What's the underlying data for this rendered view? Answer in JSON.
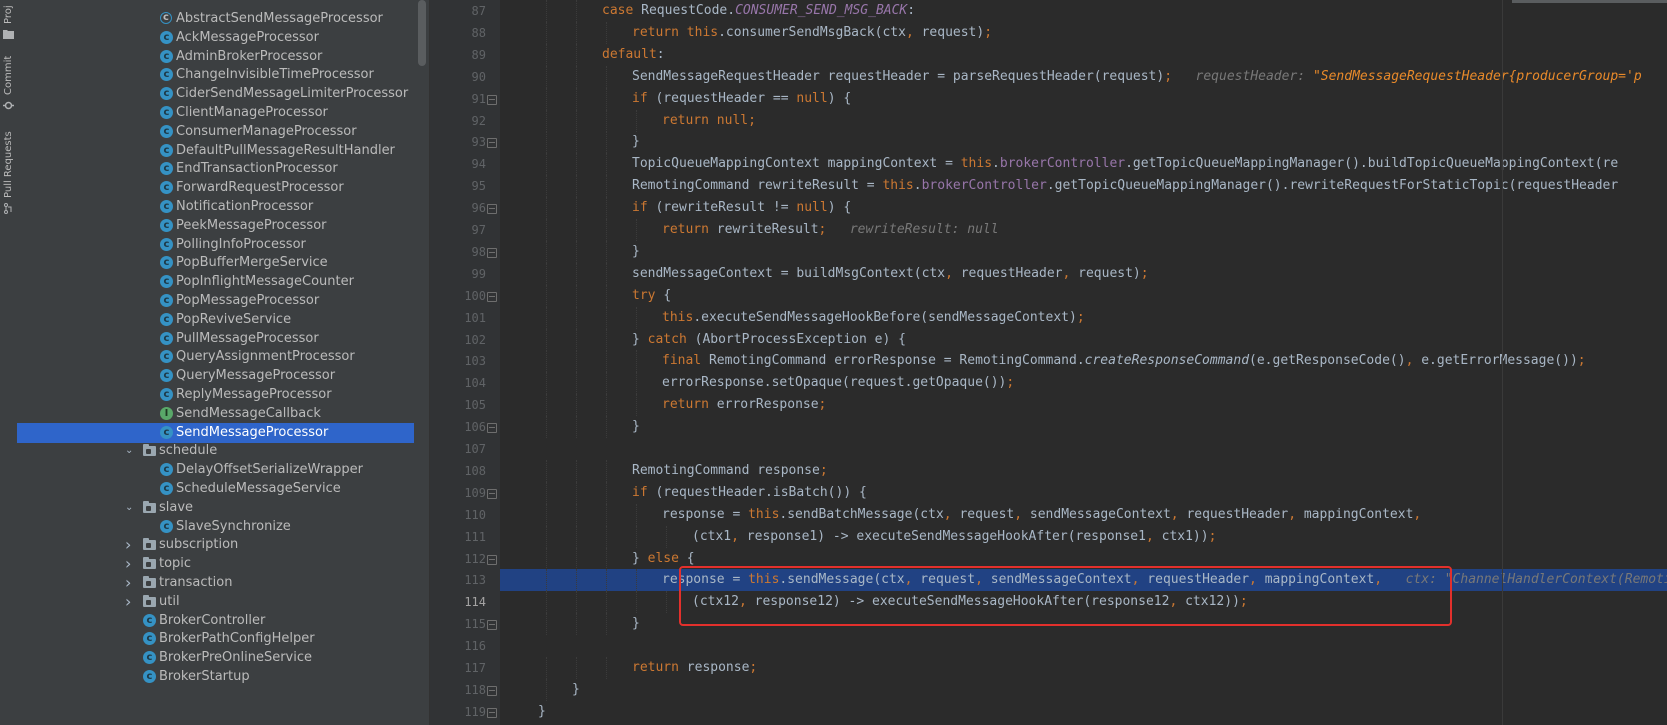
{
  "toolstrip": {
    "tabs": [
      {
        "label": "Proj"
      },
      {
        "label": "Commit"
      },
      {
        "label": "Pull Requests"
      }
    ]
  },
  "tree": {
    "items": [
      {
        "label": "AbstractSendMessageProcessor",
        "icon": "abstract-class-icon",
        "depth": 2
      },
      {
        "label": "AckMessageProcessor",
        "icon": "class-icon",
        "depth": 2
      },
      {
        "label": "AdminBrokerProcessor",
        "icon": "class-icon",
        "depth": 2
      },
      {
        "label": "ChangeInvisibleTimeProcessor",
        "icon": "class-icon",
        "depth": 2
      },
      {
        "label": "CiderSendMessageLimiterProcessor",
        "icon": "class-icon",
        "depth": 2
      },
      {
        "label": "ClientManageProcessor",
        "icon": "class-icon",
        "depth": 2
      },
      {
        "label": "ConsumerManageProcessor",
        "icon": "class-icon",
        "depth": 2
      },
      {
        "label": "DefaultPullMessageResultHandler",
        "icon": "class-icon",
        "depth": 2
      },
      {
        "label": "EndTransactionProcessor",
        "icon": "class-icon",
        "depth": 2
      },
      {
        "label": "ForwardRequestProcessor",
        "icon": "class-icon",
        "depth": 2
      },
      {
        "label": "NotificationProcessor",
        "icon": "class-icon",
        "depth": 2
      },
      {
        "label": "PeekMessageProcessor",
        "icon": "class-icon",
        "depth": 2
      },
      {
        "label": "PollingInfoProcessor",
        "icon": "class-icon",
        "depth": 2
      },
      {
        "label": "PopBufferMergeService",
        "icon": "class-icon",
        "depth": 2
      },
      {
        "label": "PopInflightMessageCounter",
        "icon": "class-icon",
        "depth": 2
      },
      {
        "label": "PopMessageProcessor",
        "icon": "class-icon",
        "depth": 2
      },
      {
        "label": "PopReviveService",
        "icon": "class-icon",
        "depth": 2
      },
      {
        "label": "PullMessageProcessor",
        "icon": "class-icon",
        "depth": 2
      },
      {
        "label": "QueryAssignmentProcessor",
        "icon": "class-icon",
        "depth": 2
      },
      {
        "label": "QueryMessageProcessor",
        "icon": "class-icon",
        "depth": 2
      },
      {
        "label": "ReplyMessageProcessor",
        "icon": "class-icon",
        "depth": 2
      },
      {
        "label": "SendMessageCallback",
        "icon": "interface-icon",
        "depth": 2
      },
      {
        "label": "SendMessageProcessor",
        "icon": "class-icon",
        "depth": 2,
        "selected": true
      },
      {
        "label": "schedule",
        "icon": "folder-icon",
        "depth": 1,
        "arrow": "expanded"
      },
      {
        "label": "DelayOffsetSerializeWrapper",
        "icon": "class-icon",
        "depth": 2
      },
      {
        "label": "ScheduleMessageService",
        "icon": "class-icon",
        "depth": 2
      },
      {
        "label": "slave",
        "icon": "folder-icon",
        "depth": 1,
        "arrow": "expanded"
      },
      {
        "label": "SlaveSynchronize",
        "icon": "class-icon",
        "depth": 2
      },
      {
        "label": "subscription",
        "icon": "folder-icon",
        "depth": 1,
        "arrow": "collapsed"
      },
      {
        "label": "topic",
        "icon": "folder-icon",
        "depth": 1,
        "arrow": "collapsed"
      },
      {
        "label": "transaction",
        "icon": "folder-icon",
        "depth": 1,
        "arrow": "collapsed"
      },
      {
        "label": "util",
        "icon": "folder-icon",
        "depth": 1,
        "arrow": "collapsed"
      },
      {
        "label": "BrokerController",
        "icon": "class-icon",
        "depth": 1
      },
      {
        "label": "BrokerPathConfigHelper",
        "icon": "class-icon",
        "depth": 1
      },
      {
        "label": "BrokerPreOnlineService",
        "icon": "class-icon",
        "depth": 1
      },
      {
        "label": "BrokerStartup",
        "icon": "class-icon",
        "depth": 1
      }
    ]
  },
  "editor": {
    "current_line": "114",
    "lines": [
      {
        "n": "87",
        "indent": 3,
        "fold": false,
        "segs": [
          [
            "kw",
            "case "
          ],
          [
            "t",
            "RequestCode."
          ],
          [
            "itl",
            "CONSUMER_SEND_MSG_BACK"
          ],
          [
            "t",
            ":"
          ]
        ]
      },
      {
        "n": "88",
        "indent": 4,
        "fold": false,
        "segs": [
          [
            "kw",
            "return this"
          ],
          [
            "t",
            ".consumerSendMsgBack(ctx"
          ],
          [
            "kw",
            ", "
          ],
          [
            "t",
            "request)"
          ],
          [
            "kw",
            ";"
          ]
        ]
      },
      {
        "n": "89",
        "indent": 3,
        "fold": false,
        "segs": [
          [
            "kw",
            "default"
          ],
          [
            "t",
            ":"
          ]
        ]
      },
      {
        "n": "90",
        "indent": 4,
        "fold": false,
        "segs": [
          [
            "t",
            "SendMessageRequestHeader requestHeader = parseRequestHeader(request)"
          ],
          [
            "kw",
            ";"
          ],
          [
            "hint",
            "   requestHeader: "
          ],
          [
            "hintstr",
            "\"SendMessageRequestHeader{producerGroup='p"
          ]
        ]
      },
      {
        "n": "91",
        "indent": 4,
        "fold": true,
        "segs": [
          [
            "kw",
            "if "
          ],
          [
            "t",
            "(requestHeader == "
          ],
          [
            "kw",
            "null"
          ],
          [
            "t",
            ") {"
          ]
        ]
      },
      {
        "n": "92",
        "indent": 5,
        "fold": false,
        "segs": [
          [
            "kw",
            "return null;"
          ]
        ]
      },
      {
        "n": "93",
        "indent": 4,
        "fold": true,
        "segs": [
          [
            "t",
            "}"
          ]
        ]
      },
      {
        "n": "94",
        "indent": 4,
        "fold": false,
        "segs": [
          [
            "t",
            "TopicQueueMappingContext mappingContext = "
          ],
          [
            "kw",
            "this"
          ],
          [
            "t",
            "."
          ],
          [
            "fld",
            "brokerController"
          ],
          [
            "t",
            ".getTopicQueueMappingManager().buildTopicQueueMappingContext(re"
          ]
        ]
      },
      {
        "n": "95",
        "indent": 4,
        "fold": false,
        "segs": [
          [
            "t",
            "RemotingCommand rewriteResult = "
          ],
          [
            "kw",
            "this"
          ],
          [
            "t",
            "."
          ],
          [
            "fld",
            "brokerController"
          ],
          [
            "t",
            ".getTopicQueueMappingManager().rewriteRequestForStaticTopic(requestHeader"
          ]
        ]
      },
      {
        "n": "96",
        "indent": 4,
        "fold": true,
        "segs": [
          [
            "kw",
            "if "
          ],
          [
            "t",
            "(rewriteResult != "
          ],
          [
            "kw",
            "null"
          ],
          [
            "t",
            ") {"
          ]
        ]
      },
      {
        "n": "97",
        "indent": 5,
        "fold": false,
        "segs": [
          [
            "kw",
            "return "
          ],
          [
            "t",
            "rewriteResult"
          ],
          [
            "kw",
            ";"
          ],
          [
            "hint",
            "   rewriteResult: null"
          ]
        ]
      },
      {
        "n": "98",
        "indent": 4,
        "fold": true,
        "segs": [
          [
            "t",
            "}"
          ]
        ]
      },
      {
        "n": "99",
        "indent": 4,
        "fold": false,
        "segs": [
          [
            "t",
            "sendMessageContext = buildMsgContext(ctx"
          ],
          [
            "kw",
            ", "
          ],
          [
            "t",
            "requestHeader"
          ],
          [
            "kw",
            ", "
          ],
          [
            "t",
            "request)"
          ],
          [
            "kw",
            ";"
          ]
        ]
      },
      {
        "n": "100",
        "indent": 4,
        "fold": true,
        "segs": [
          [
            "kw",
            "try "
          ],
          [
            "t",
            "{"
          ]
        ]
      },
      {
        "n": "101",
        "indent": 5,
        "fold": false,
        "segs": [
          [
            "kw",
            "this"
          ],
          [
            "t",
            ".executeSendMessageHookBefore(sendMessageContext)"
          ],
          [
            "kw",
            ";"
          ]
        ]
      },
      {
        "n": "102",
        "indent": 4,
        "fold": false,
        "segs": [
          [
            "t",
            "} "
          ],
          [
            "kw",
            "catch "
          ],
          [
            "t",
            "(AbortProcessException e) {"
          ]
        ]
      },
      {
        "n": "103",
        "indent": 5,
        "fold": false,
        "segs": [
          [
            "kw",
            "final "
          ],
          [
            "t",
            "RemotingCommand errorResponse = RemotingCommand."
          ],
          [
            "it",
            "createResponseCommand"
          ],
          [
            "t",
            "(e.getResponseCode()"
          ],
          [
            "kw",
            ", "
          ],
          [
            "t",
            "e.getErrorMessage())"
          ],
          [
            "kw",
            ";"
          ]
        ]
      },
      {
        "n": "104",
        "indent": 5,
        "fold": false,
        "segs": [
          [
            "t",
            "errorResponse.setOpaque(request.getOpaque())"
          ],
          [
            "kw",
            ";"
          ]
        ]
      },
      {
        "n": "105",
        "indent": 5,
        "fold": false,
        "segs": [
          [
            "kw",
            "return "
          ],
          [
            "t",
            "errorResponse"
          ],
          [
            "kw",
            ";"
          ]
        ]
      },
      {
        "n": "106",
        "indent": 4,
        "fold": true,
        "segs": [
          [
            "t",
            "}"
          ]
        ]
      },
      {
        "n": "107",
        "indent": 0,
        "fold": false,
        "segs": []
      },
      {
        "n": "108",
        "indent": 4,
        "fold": false,
        "segs": [
          [
            "t",
            "RemotingCommand response"
          ],
          [
            "kw",
            ";"
          ]
        ]
      },
      {
        "n": "109",
        "indent": 4,
        "fold": true,
        "segs": [
          [
            "kw",
            "if "
          ],
          [
            "t",
            "(requestHeader.isBatch()) {"
          ]
        ]
      },
      {
        "n": "110",
        "indent": 5,
        "fold": false,
        "segs": [
          [
            "t",
            "response = "
          ],
          [
            "kw",
            "this"
          ],
          [
            "t",
            ".sendBatchMessage(ctx"
          ],
          [
            "kw",
            ", "
          ],
          [
            "t",
            "request"
          ],
          [
            "kw",
            ", "
          ],
          [
            "t",
            "sendMessageContext"
          ],
          [
            "kw",
            ", "
          ],
          [
            "t",
            "requestHeader"
          ],
          [
            "kw",
            ", "
          ],
          [
            "t",
            "mappingContext"
          ],
          [
            "kw",
            ","
          ]
        ]
      },
      {
        "n": "111",
        "indent": 6,
        "fold": false,
        "segs": [
          [
            "t",
            "(ctx1"
          ],
          [
            "kw",
            ", "
          ],
          [
            "t",
            "response1) -> executeSendMessageHookAfter(response1"
          ],
          [
            "kw",
            ", "
          ],
          [
            "t",
            "ctx1))"
          ],
          [
            "kw",
            ";"
          ]
        ]
      },
      {
        "n": "112",
        "indent": 4,
        "fold": true,
        "segs": [
          [
            "t",
            "} "
          ],
          [
            "kw",
            "else "
          ],
          [
            "t",
            "{"
          ]
        ]
      },
      {
        "n": "113",
        "indent": 5,
        "fold": false,
        "hl": true,
        "segs": [
          [
            "t",
            "response = "
          ],
          [
            "kw",
            "this"
          ],
          [
            "t",
            ".sendMessage(ctx"
          ],
          [
            "kw",
            ", "
          ],
          [
            "t",
            "request"
          ],
          [
            "kw",
            ", "
          ],
          [
            "t",
            "sendMessageContext"
          ],
          [
            "kw",
            ", "
          ],
          [
            "t",
            "requestHeader"
          ],
          [
            "kw",
            ", "
          ],
          [
            "t",
            "mappingContext"
          ],
          [
            "kw",
            ","
          ],
          [
            "hint",
            "   ctx: \"ChannelHandlerContext(RemotingSe"
          ]
        ]
      },
      {
        "n": "114",
        "indent": 6,
        "fold": false,
        "segs": [
          [
            "t",
            "(ctx12"
          ],
          [
            "kw",
            ", "
          ],
          [
            "t",
            "response12) -> executeSendMessageHookAfter(response12"
          ],
          [
            "kw",
            ", "
          ],
          [
            "t",
            "ctx12))"
          ],
          [
            "kw",
            ";"
          ]
        ]
      },
      {
        "n": "115",
        "indent": 4,
        "fold": true,
        "segs": [
          [
            "t",
            "}"
          ]
        ]
      },
      {
        "n": "116",
        "indent": 0,
        "fold": false,
        "segs": []
      },
      {
        "n": "117",
        "indent": 4,
        "fold": false,
        "segs": [
          [
            "kw",
            "return "
          ],
          [
            "t",
            "response"
          ],
          [
            "kw",
            ";"
          ]
        ]
      },
      {
        "n": "118",
        "indent": 2,
        "fold": true,
        "segs": [
          [
            "t",
            "}"
          ]
        ]
      },
      {
        "n": "119",
        "indent": 1,
        "fold": true,
        "segs": [
          [
            "t",
            "}"
          ]
        ]
      }
    ]
  }
}
